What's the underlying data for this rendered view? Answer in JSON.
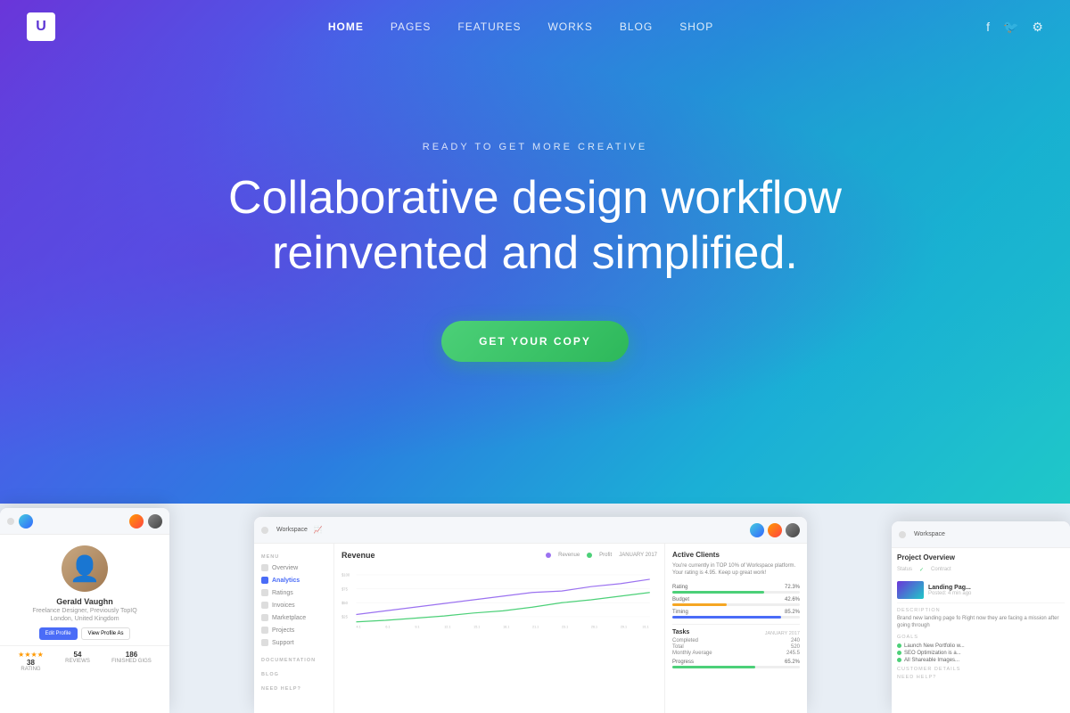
{
  "navbar": {
    "logo": "U",
    "links": [
      {
        "label": "HOME",
        "active": true
      },
      {
        "label": "PAGES",
        "active": false
      },
      {
        "label": "FEATURES",
        "active": false
      },
      {
        "label": "WORKS",
        "active": false
      },
      {
        "label": "BLOG",
        "active": false
      },
      {
        "label": "SHOP",
        "active": false
      }
    ],
    "social": [
      "f",
      "t",
      "⚙"
    ]
  },
  "hero": {
    "subtitle": "READY TO GET MORE CREATIVE",
    "title_line1": "Collaborative design workflow",
    "title_line2": "reinvented and simplified.",
    "cta": "GET YOUR COPY"
  },
  "profile_card": {
    "name": "Gerald Vaughn",
    "role": "Freelance Designer, Previously TopIQ",
    "location": "London, United Kingdom",
    "btn_edit": "Edit Profile",
    "btn_view": "View Profile As",
    "stats": [
      {
        "num": "38",
        "label": "RATING"
      },
      {
        "num": "54",
        "label": "REVIEWS"
      },
      {
        "num": "186",
        "label": "FINISHED GIGS"
      }
    ]
  },
  "analytics_card": {
    "workspace_label": "Workspace",
    "menu_section": "MENU",
    "menu_items": [
      {
        "label": "Overview",
        "active": false
      },
      {
        "label": "Analytics",
        "active": true
      },
      {
        "label": "Ratings",
        "active": false
      },
      {
        "label": "Invoices",
        "active": false
      },
      {
        "label": "Marketplace",
        "active": false
      },
      {
        "label": "Projects",
        "active": false
      },
      {
        "label": "Support",
        "active": false
      }
    ],
    "doc_section": "DOCUMENTATION",
    "blog_section": "BLOG",
    "help_section": "NEED HELP?",
    "revenue_title": "Revenue",
    "legend_revenue": "Revenue",
    "legend_profit": "Profit",
    "date_label": "JANUARY 2017",
    "active_clients_title": "Active Clients",
    "clients_desc": "You're currently in TOP 10% of Workspace platform. Your rating is 4.95. Keep up great work!",
    "metrics": [
      {
        "label": "Rating",
        "value": "72.3%",
        "pct": 72,
        "color": "#4cd078"
      },
      {
        "label": "Budget",
        "value": "42.6%",
        "pct": 43,
        "color": "#4a6cf7"
      },
      {
        "label": "Timing",
        "value": "85.2%",
        "pct": 85,
        "color": "#4a6cf7"
      }
    ],
    "tasks_title": "Tasks",
    "tasks_date": "JANUARY 2017",
    "tasks": [
      {
        "label": "Completed",
        "value": "240"
      },
      {
        "label": "Total",
        "value": "520"
      },
      {
        "label": "Monthly Average",
        "value": "245.5"
      }
    ],
    "progress_label": "Progress",
    "progress_value": "65.2%"
  },
  "project_card": {
    "workspace_label": "Workspace",
    "overview_title": "Project Overview",
    "status_label": "Status",
    "contract_label": "Contract",
    "project_name": "Landing Pag...",
    "project_sub": "Posted: 4 min ago",
    "description_label": "DESCRIPTION",
    "description_text": "Brand new landing page fo Right now they are facing a mission after going through",
    "goals_label": "GOALS",
    "goals": [
      "Launch New Portfolio w...",
      "SEO Optimization is a...",
      "All Shareable Images..."
    ],
    "customer_label": "CUSTOMER DETAILS",
    "need_help_label": "NEED HELP?"
  },
  "colors": {
    "accent_blue": "#4a6cf7",
    "accent_green": "#4cd078",
    "hero_gradient_start": "#6a35d9",
    "hero_gradient_end": "#1fc8c8"
  }
}
